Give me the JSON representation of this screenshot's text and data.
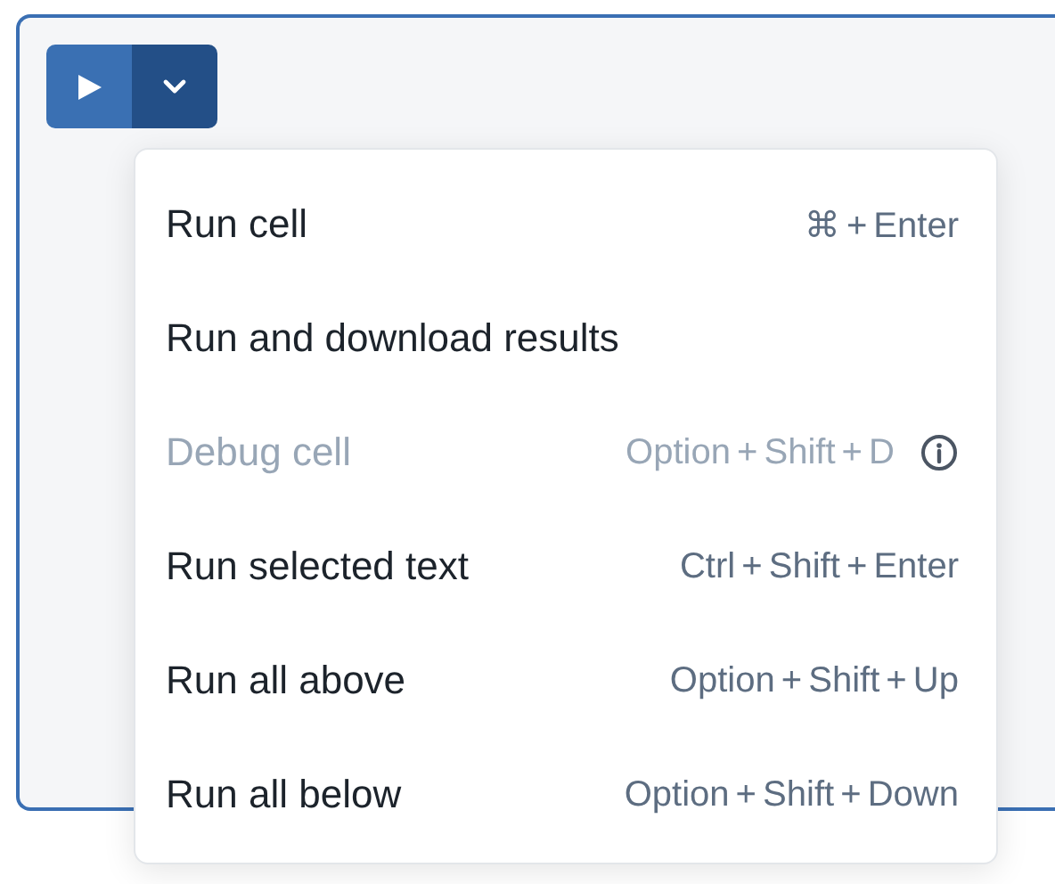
{
  "run_menu": {
    "items": [
      {
        "label": "Run cell",
        "shortcut": "⌘ + Enter",
        "disabled": false,
        "info_icon": false
      },
      {
        "label": "Run and download results",
        "disabled": false,
        "info_icon": false
      },
      {
        "label": "Debug cell",
        "shortcut": "Option + Shift + D",
        "disabled": true,
        "info_icon": true
      },
      {
        "label": "Run selected text",
        "shortcut": "Ctrl + Shift + Enter",
        "disabled": false,
        "info_icon": false
      },
      {
        "label": "Run all above",
        "shortcut": "Option + Shift + Up",
        "disabled": false,
        "info_icon": false
      },
      {
        "label": "Run all below",
        "shortcut": "Option + Shift + Down",
        "disabled": false,
        "info_icon": false
      }
    ]
  }
}
